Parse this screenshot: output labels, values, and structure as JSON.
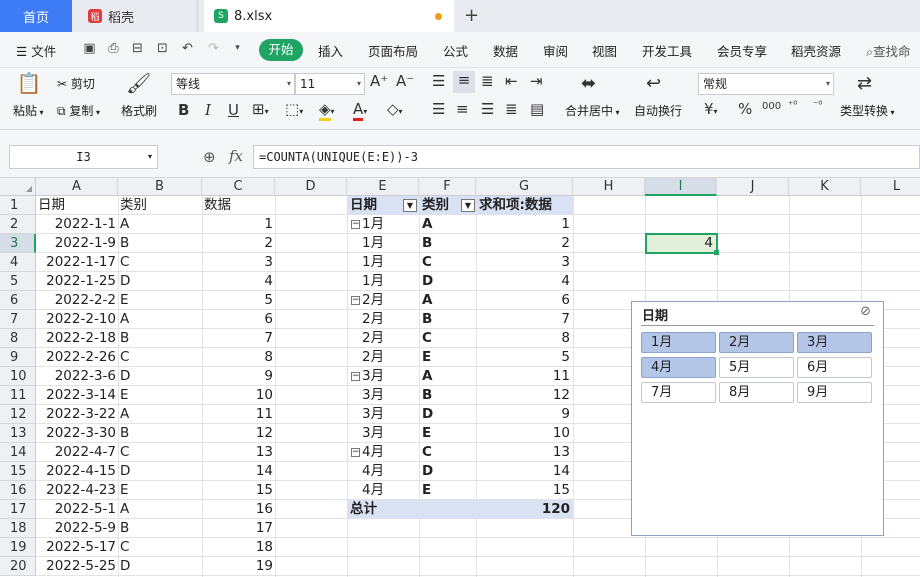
{
  "tabs": {
    "home": "首页",
    "daoke": "稻壳",
    "file": "8.xlsx"
  },
  "menu": {
    "file": "文件",
    "items": [
      "开始",
      "插入",
      "页面布局",
      "公式",
      "数据",
      "审阅",
      "视图",
      "开发工具",
      "会员专享",
      "稻壳资源"
    ],
    "search": "查找命"
  },
  "ribbon": {
    "paste": "粘贴",
    "cut": "剪切",
    "copy": "复制",
    "format_painter": "格式刷",
    "font_name": "等线",
    "font_size": "11",
    "merge_center": "合并居中",
    "wrap_text": "自动换行",
    "number_format": "常规",
    "type_convert": "类型转换"
  },
  "formula_bar": {
    "name_box": "I3",
    "fx": "fx",
    "formula": "=COUNTA(UNIQUE(E:E))-3"
  },
  "columns": [
    "A",
    "B",
    "C",
    "D",
    "E",
    "F",
    "G",
    "H",
    "I",
    "J",
    "K",
    "L"
  ],
  "rows": [
    "1",
    "2",
    "3",
    "4",
    "5",
    "6",
    "7",
    "8",
    "9",
    "10",
    "11",
    "12",
    "13",
    "14",
    "15",
    "16",
    "17",
    "18",
    "19",
    "20"
  ],
  "source_table": {
    "headers": [
      "日期",
      "类别",
      "数据"
    ],
    "dates": [
      "2022-1-1",
      "2022-1-9",
      "2022-1-17",
      "2022-1-25",
      "2022-2-2",
      "2022-2-10",
      "2022-2-18",
      "2022-2-26",
      "2022-3-6",
      "2022-3-14",
      "2022-3-22",
      "2022-3-30",
      "2022-4-7",
      "2022-4-15",
      "2022-4-23",
      "2022-5-1",
      "2022-5-9",
      "2022-5-17",
      "2022-5-25"
    ],
    "categories": [
      "A",
      "B",
      "C",
      "D",
      "E",
      "A",
      "B",
      "C",
      "D",
      "E",
      "A",
      "B",
      "C",
      "D",
      "E",
      "A",
      "B",
      "C",
      "D"
    ],
    "values": [
      "1",
      "2",
      "3",
      "4",
      "5",
      "6",
      "7",
      "8",
      "9",
      "10",
      "11",
      "12",
      "13",
      "14",
      "15",
      "16",
      "17",
      "18",
      "19"
    ]
  },
  "pivot": {
    "headers": [
      "日期",
      "类别",
      "求和项:数据"
    ],
    "rows": [
      {
        "date": "1月",
        "cat": "A",
        "val": "1"
      },
      {
        "date": "1月",
        "cat": "B",
        "val": "2"
      },
      {
        "date": "1月",
        "cat": "C",
        "val": "3"
      },
      {
        "date": "1月",
        "cat": "D",
        "val": "4"
      },
      {
        "date": "2月",
        "cat": "A",
        "val": "6"
      },
      {
        "date": "2月",
        "cat": "B",
        "val": "7"
      },
      {
        "date": "2月",
        "cat": "C",
        "val": "8"
      },
      {
        "date": "2月",
        "cat": "E",
        "val": "5"
      },
      {
        "date": "3月",
        "cat": "A",
        "val": "11"
      },
      {
        "date": "3月",
        "cat": "B",
        "val": "12"
      },
      {
        "date": "3月",
        "cat": "D",
        "val": "9"
      },
      {
        "date": "3月",
        "cat": "E",
        "val": "10"
      },
      {
        "date": "4月",
        "cat": "C",
        "val": "13"
      },
      {
        "date": "4月",
        "cat": "D",
        "val": "14"
      },
      {
        "date": "4月",
        "cat": "E",
        "val": "15"
      }
    ],
    "group_rows": [
      0,
      4,
      8,
      12
    ],
    "total_label": "总计",
    "total_value": "120"
  },
  "active_cell": {
    "ref": "I3",
    "value": "4"
  },
  "slicer": {
    "title": "日期",
    "items": [
      {
        "label": "1月",
        "selected": true
      },
      {
        "label": "2月",
        "selected": true
      },
      {
        "label": "3月",
        "selected": true
      },
      {
        "label": "4月",
        "selected": true
      },
      {
        "label": "5月",
        "selected": false
      },
      {
        "label": "6月",
        "selected": false
      },
      {
        "label": "7月",
        "selected": false
      },
      {
        "label": "8月",
        "selected": false
      },
      {
        "label": "9月",
        "selected": false
      }
    ]
  },
  "colors": {
    "accent_green": "#1fa463",
    "home_tab": "#3d7cf5",
    "pivot_header": "#d9e1f2",
    "slicer_selected": "#b4c6e7"
  }
}
